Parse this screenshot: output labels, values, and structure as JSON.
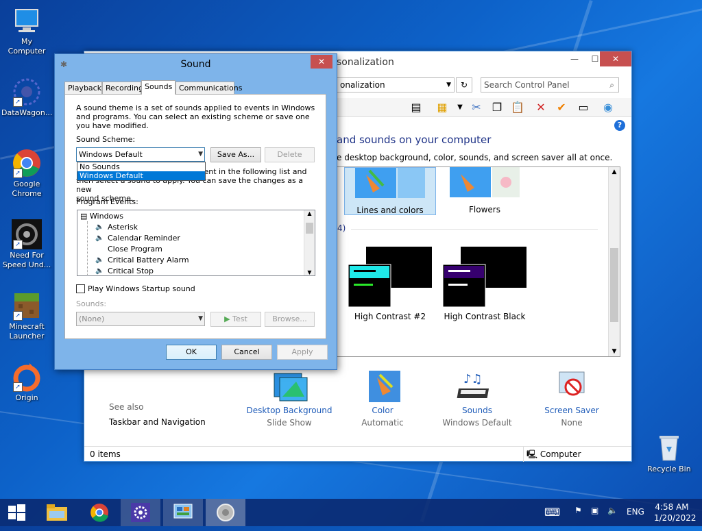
{
  "desktop": {
    "icons": [
      {
        "label": "My Computer",
        "icon": "computer-icon"
      },
      {
        "label": "DataWagon...",
        "icon": "datawagon-icon"
      },
      {
        "label": "Google Chrome",
        "icon": "chrome-icon"
      },
      {
        "label": "Need For Speed Und...",
        "icon": "need-for-speed-icon"
      },
      {
        "label": "Minecraft Launcher",
        "icon": "minecraft-icon"
      },
      {
        "label": "Origin",
        "icon": "origin-icon"
      }
    ],
    "recycle_bin": "Recycle Bin"
  },
  "personalization": {
    "title": "sonalization",
    "address": "onalization",
    "search_placeholder": "Search Control Panel",
    "heading": "and sounds on your computer",
    "subheading": "e desktop background, color, sounds, and screen saver all at once.",
    "section_count": "4)",
    "themes": [
      {
        "label": "Lines and colors",
        "selected": true
      },
      {
        "label": "Flowers",
        "selected": false
      },
      {
        "label": "High Contrast #2",
        "selected": false
      },
      {
        "label": "High Contrast Black",
        "selected": false
      }
    ],
    "see_also": {
      "label": "See also",
      "link": "Taskbar and Navigation"
    },
    "bottom_items": [
      {
        "label": "Desktop Background",
        "value": "Slide Show",
        "icon": "desktop-background-icon"
      },
      {
        "label": "Color",
        "value": "Automatic",
        "icon": "color-icon"
      },
      {
        "label": "Sounds",
        "value": "Windows Default",
        "icon": "sounds-icon"
      },
      {
        "label": "Screen Saver",
        "value": "None",
        "icon": "screen-saver-icon"
      }
    ],
    "status": {
      "items": "0 items",
      "location": "Computer"
    }
  },
  "sound_dialog": {
    "title": "Sound",
    "tabs": [
      "Playback",
      "Recording",
      "Sounds",
      "Communications"
    ],
    "active_tab": "Sounds",
    "description": "A sound theme is a set of sounds applied to events in Windows and programs.  You can select an existing scheme or save one you have modified.",
    "scheme_label": "Sound Scheme:",
    "scheme_value": "Windows Default",
    "scheme_options": [
      "No Sounds",
      "Windows Default"
    ],
    "save_as": "Save As...",
    "delete": "Delete",
    "change_text_line1": "vent in the following list and",
    "change_text_line2": "then select a sound to apply.  You can save the changes as a new",
    "change_text_line3": "sound scheme.",
    "program_events_label": "Program Events:",
    "events_root": "Windows",
    "events": [
      {
        "name": "Asterisk",
        "has_sound": true
      },
      {
        "name": "Calendar Reminder",
        "has_sound": true
      },
      {
        "name": "Close Program",
        "has_sound": false
      },
      {
        "name": "Critical Battery Alarm",
        "has_sound": true
      },
      {
        "name": "Critical Stop",
        "has_sound": true
      }
    ],
    "startup_checkbox": "Play Windows Startup sound",
    "startup_checked": false,
    "sounds_label": "Sounds:",
    "sounds_value": "(None)",
    "test": "Test",
    "browse": "Browse...",
    "ok": "OK",
    "cancel": "Cancel",
    "apply": "Apply"
  },
  "taskbar": {
    "items": [
      "start",
      "file-explorer",
      "chrome",
      "settings",
      "control-panel",
      "sound"
    ],
    "language": "ENG",
    "time": "4:58 AM",
    "date": "1/20/2022"
  }
}
